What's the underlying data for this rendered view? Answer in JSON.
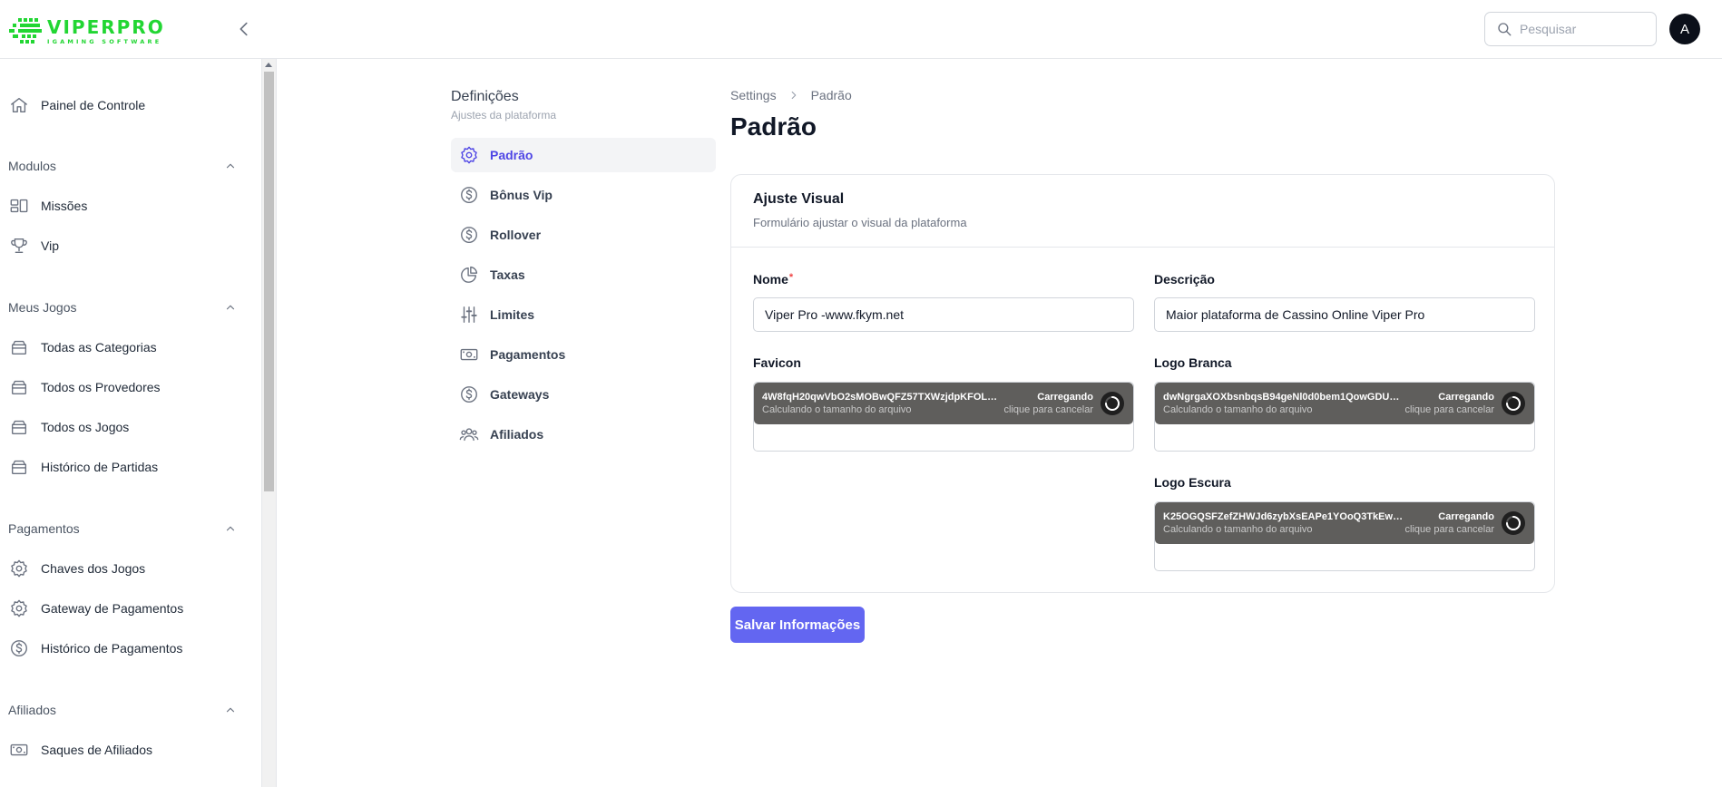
{
  "brand": {
    "name": "VIPERPRO",
    "tagline": "IGAMING SOFTWARE",
    "color": "#22d633"
  },
  "header": {
    "search_placeholder": "Pesquisar",
    "avatar_initial": "A"
  },
  "sidebar": {
    "dashboard": {
      "label": "Painel de Controle",
      "icon": "home-icon"
    },
    "sections": [
      {
        "title": "Modulos",
        "items": [
          {
            "label": "Missões",
            "icon": "missions-icon"
          },
          {
            "label": "Vip",
            "icon": "trophy-icon"
          }
        ]
      },
      {
        "title": "Meus Jogos",
        "items": [
          {
            "label": "Todas as Categorias",
            "icon": "box-icon"
          },
          {
            "label": "Todos os Provedores",
            "icon": "box-icon"
          },
          {
            "label": "Todos os Jogos",
            "icon": "box-icon"
          },
          {
            "label": "Histórico de Partidas",
            "icon": "box-icon"
          }
        ]
      },
      {
        "title": "Pagamentos",
        "items": [
          {
            "label": "Chaves dos Jogos",
            "icon": "gear-icon"
          },
          {
            "label": "Gateway de Pagamentos",
            "icon": "gear-icon"
          },
          {
            "label": "Histórico de Pagamentos",
            "icon": "dollar-icon"
          }
        ]
      },
      {
        "title": "Afiliados",
        "items": [
          {
            "label": "Saques de Afiliados",
            "icon": "banknote-icon"
          }
        ]
      }
    ]
  },
  "settings_nav": {
    "title": "Definições",
    "subtitle": "Ajustes da plataforma",
    "items": [
      {
        "label": "Padrão",
        "icon": "gear-icon",
        "active": true
      },
      {
        "label": "Bônus Vip",
        "icon": "dollar-icon"
      },
      {
        "label": "Rollover",
        "icon": "dollar-icon"
      },
      {
        "label": "Taxas",
        "icon": "pie-chart-icon"
      },
      {
        "label": "Limites",
        "icon": "sliders-icon"
      },
      {
        "label": "Pagamentos",
        "icon": "banknote-icon"
      },
      {
        "label": "Gateways",
        "icon": "dollar-icon"
      },
      {
        "label": "Afiliados",
        "icon": "users-icon"
      }
    ]
  },
  "breadcrumb": [
    "Settings",
    "Padrão"
  ],
  "page_title": "Padrão",
  "form": {
    "title": "Ajuste Visual",
    "subtitle": "Formulário ajustar o visual da plataforma",
    "nome": {
      "label": "Nome",
      "required_mark": "*",
      "value": "Viper Pro -www.fkym.net"
    },
    "descricao": {
      "label": "Descrição",
      "value": "Maior plataforma de Cassino Online Viper Pro"
    },
    "favicon": {
      "label": "Favicon",
      "file": "4W8fqH20qwVbO2sMOBwQFZ57TXWzjdpKFOLKWN...",
      "size_text": "Calculando o tamanho do arquivo",
      "status": "Carregando",
      "cancel": "clique para cancelar"
    },
    "logo_branca": {
      "label": "Logo Branca",
      "file": "dwNgrgaXOXbsnbqsB94geNl0d0bem1QowGDUzsIT.p...",
      "size_text": "Calculando o tamanho do arquivo",
      "status": "Carregando",
      "cancel": "clique para cancelar"
    },
    "logo_escura": {
      "label": "Logo Escura",
      "file": "K25OGQSFZefZHWJd6zybXsEAPe1YOoQ3TkEw1LAK...",
      "size_text": "Calculando o tamanho do arquivo",
      "status": "Carregando",
      "cancel": "clique para cancelar"
    },
    "save_label": "Salvar Informações"
  },
  "colors": {
    "accent": "#6366f1",
    "active_nav": "#4f46e5",
    "upload_bg": "#5f5e5c",
    "required": "#ef4444"
  }
}
